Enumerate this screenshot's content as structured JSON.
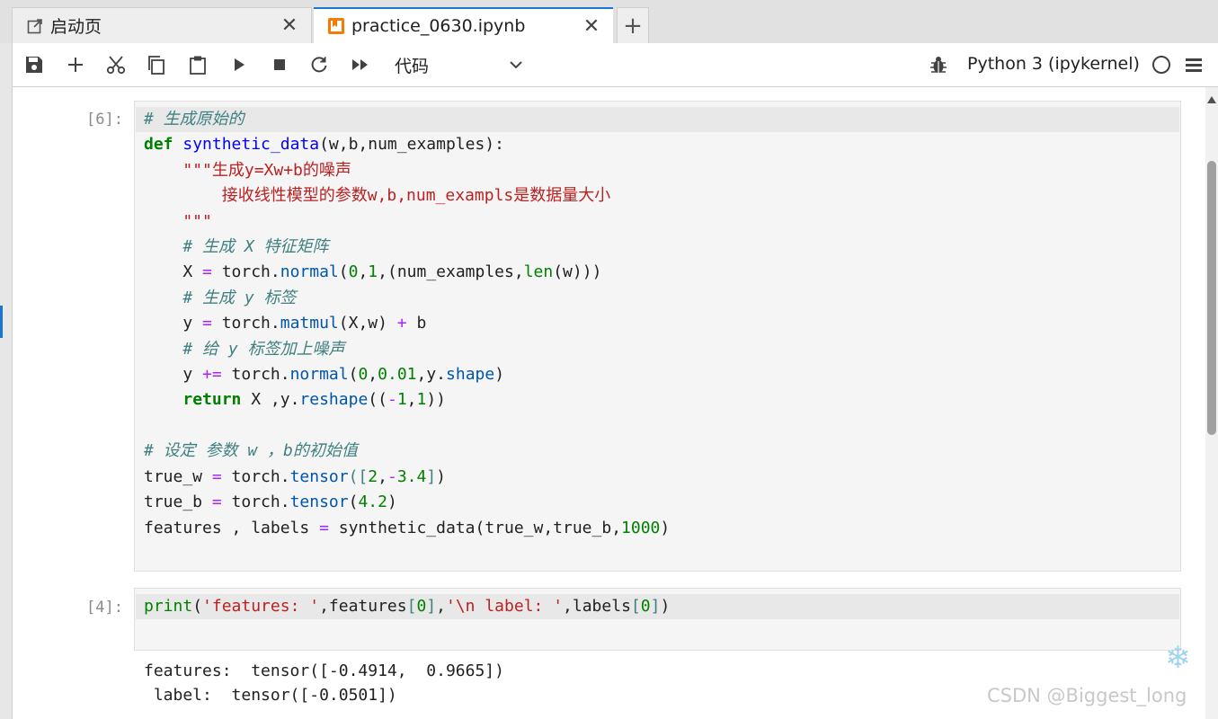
{
  "tabs": [
    {
      "label": "启动页",
      "icon": "launcher-icon"
    },
    {
      "label": "practice_0630.ipynb",
      "icon": "notebook-icon"
    }
  ],
  "toolbar": {
    "buttons": [
      "save",
      "insert-cell",
      "cut",
      "copy",
      "paste",
      "run",
      "stop",
      "restart",
      "run-all"
    ],
    "cell_type": "代码",
    "kernel_name": "Python 3 (ipykernel)"
  },
  "cells": [
    {
      "prompt": "[6]:"
    },
    {
      "prompt": "[4]:",
      "output": "features:  tensor([-0.4914,  0.9665])\n label:  tensor([-0.0501])"
    }
  ],
  "watermark": "CSDN @Biggest_long",
  "colors": {
    "accent": "#1976d2",
    "cell_bg": "#f5f5f5",
    "keyword": "#008000",
    "comment": "#408080",
    "string": "#ba2121"
  }
}
